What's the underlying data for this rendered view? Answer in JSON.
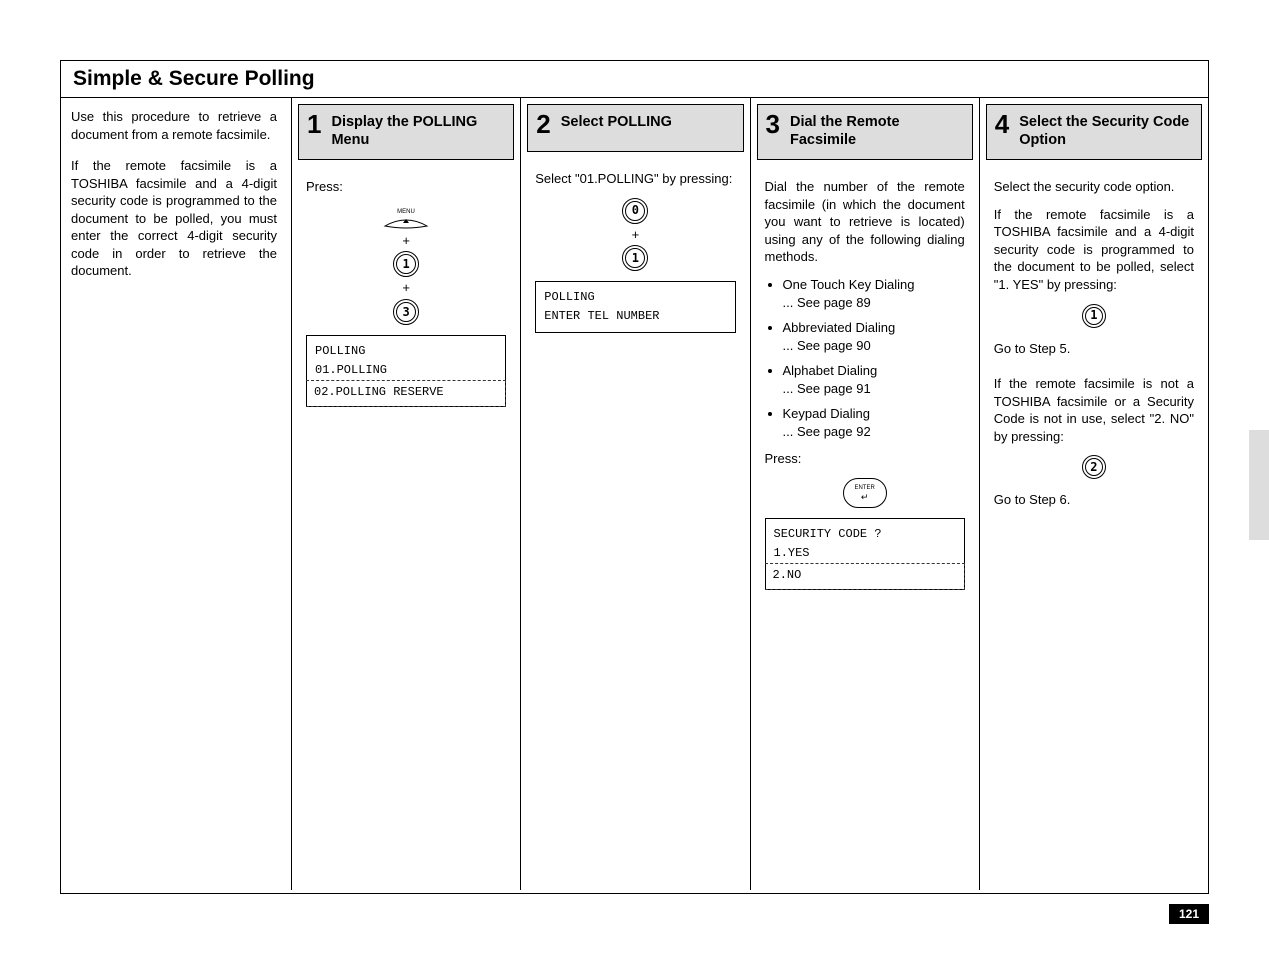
{
  "sectionTitle": "Simple & Secure Polling",
  "intro": {
    "p1": "Use this procedure to retrieve a document from a remote facsimile.",
    "p2": "If the remote facsimile is a TOSHIBA facsimile and a 4-digit security code is programmed to the document to be polled, you must enter the correct 4-digit security code in order to retrieve the document."
  },
  "step1": {
    "num": "1",
    "title": "Display the POLLING Menu",
    "pressLabel": "Press:",
    "menuLabel": "MENU",
    "key1": "1",
    "key3": "3",
    "plus": "+",
    "lcd": {
      "line1": "POLLING",
      "line2": "01.POLLING",
      "line3": "02.POLLING RESERVE"
    }
  },
  "step2": {
    "num": "2",
    "title": "Select POLLING",
    "selectLabel": "Select \"01.POLLING\" by pressing:",
    "key0": "0",
    "key1": "1",
    "plus": "+",
    "lcd": {
      "line1": "POLLING",
      "line2": "ENTER TEL NUMBER"
    }
  },
  "step3": {
    "num": "3",
    "title": "Dial the Remote Facsimile",
    "p1": "Dial the number of the remote facsimile (in which the document you want to retrieve is located) using any of the following dialing methods.",
    "items": [
      {
        "name": "One Touch Key Dialing",
        "ref": "... See page 89"
      },
      {
        "name": "Abbreviated Dialing",
        "ref": "... See page 90"
      },
      {
        "name": "Alphabet Dialing",
        "ref": "... See page 91"
      },
      {
        "name": "Keypad Dialing",
        "ref": "... See page 92"
      }
    ],
    "pressLabel": "Press:",
    "enterTop": "ENTER",
    "enterArrow": "↵",
    "lcd": {
      "line1": "SECURITY CODE ?",
      "line2": "1.YES",
      "line3": "2.NO"
    }
  },
  "step4": {
    "num": "4",
    "title": "Select the Security Code Option",
    "p1": "Select the security code option.",
    "p2": "If the remote facsimile is a TOSHIBA facsimile and a 4-digit security code is programmed to the document to be polled, select \"1. YES\" by pressing:",
    "key1": "1",
    "goto5": "Go to Step 5.",
    "p3": "If the remote facsimile is not a TOSHIBA facsimile or a Security Code is not in use, select \"2. NO\" by pressing:",
    "key2": "2",
    "goto6": "Go to Step 6."
  },
  "pageNumber": "121"
}
